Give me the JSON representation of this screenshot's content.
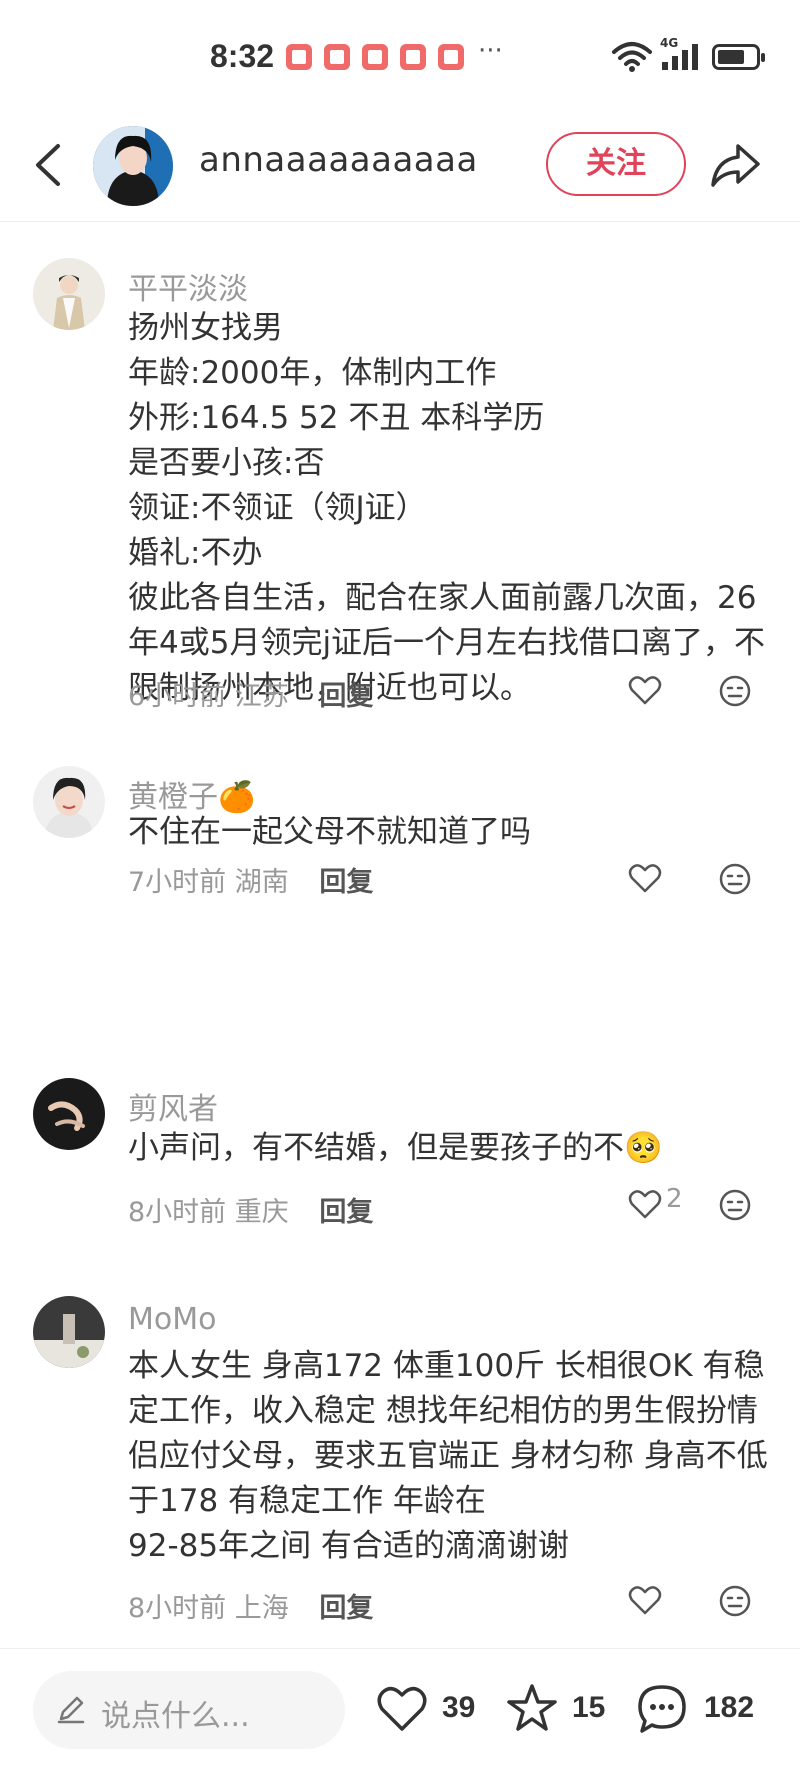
{
  "status_bar": {
    "time": "8:32",
    "network": "4G",
    "more": "···"
  },
  "header": {
    "username": "annaaaaaaaaaa",
    "follow_label": "关注"
  },
  "comments": [
    {
      "name": "平平淡淡",
      "text": "扬州女找男\n年龄:2000年，体制内工作\n外形:164.5 52 不丑 本科学历\n是否要小孩:否\n领证:不领证（领J证）\n婚礼:不办\n彼此各自生活，配合在家人面前露几次面，26年4或5月领完j证后一个月左右找借口离了，不限制扬州本地，附近也可以。",
      "time": "6小时前",
      "location": "江苏",
      "reply_label": "回复",
      "likes": ""
    },
    {
      "name": "黄橙子🍊",
      "text": "不住在一起父母不就知道了吗",
      "time": "7小时前",
      "location": "湖南",
      "reply_label": "回复",
      "likes": ""
    },
    {
      "name": "剪风者",
      "text": "小声问，有不结婚，但是要孩子的不🥺",
      "time": "8小时前",
      "location": "重庆",
      "reply_label": "回复",
      "likes": "2"
    },
    {
      "name": "MoMo",
      "text": "本人女生 身高172 体重100斤 长相很OK 有稳定工作，收入稳定 想找年纪相仿的男生假扮情侣应付父母，要求五官端正 身材匀称 身高不低于178 有稳定工作 年龄在\n92-85年之间 有合适的滴滴谢谢",
      "time": "8小时前",
      "location": "上海",
      "reply_label": "回复",
      "likes": ""
    }
  ],
  "bottom_bar": {
    "input_placeholder": "说点什么...",
    "likes": "39",
    "favorites": "15",
    "comments": "182"
  },
  "colors": {
    "accent": "#e0435a",
    "text_primary": "#333333",
    "text_secondary": "#999999"
  }
}
